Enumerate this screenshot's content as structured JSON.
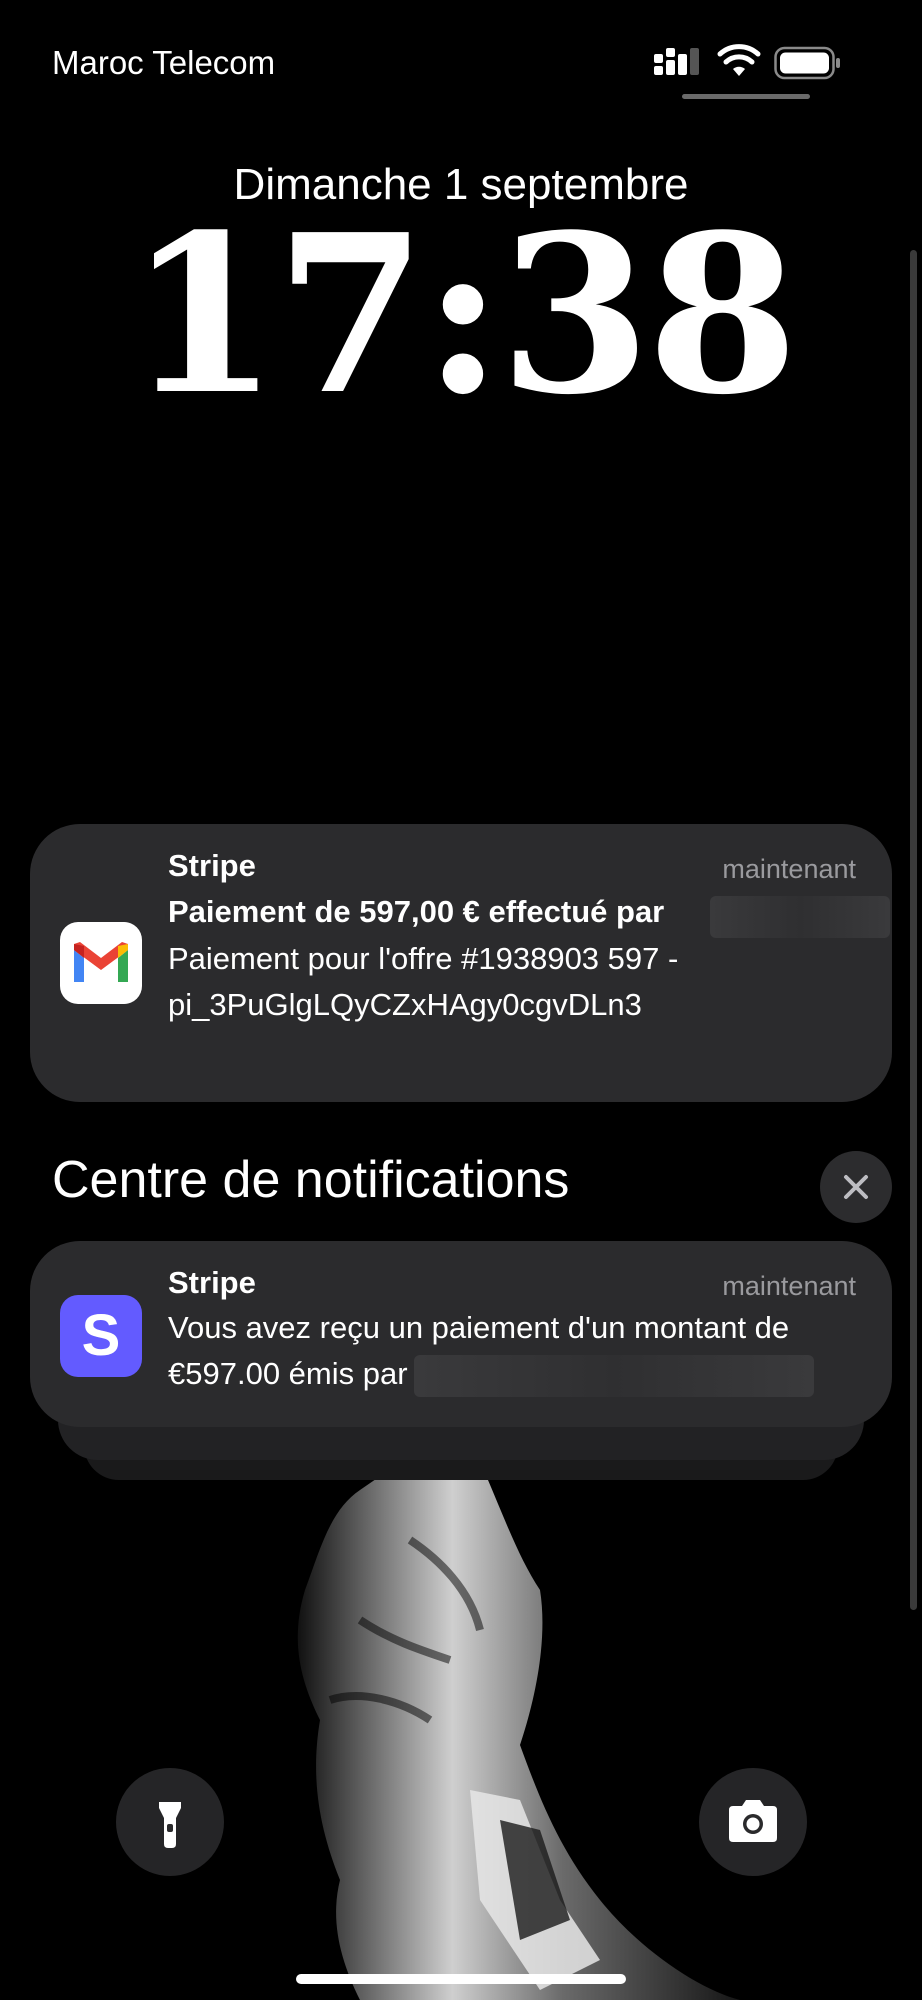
{
  "status_bar": {
    "carrier": "Maroc Telecom",
    "signal_icon": "cellular-signal-icon",
    "wifi_icon": "wifi-icon",
    "battery_icon": "battery-icon"
  },
  "lock_screen": {
    "date": "Dimanche 1 septembre",
    "time": "17:38"
  },
  "notifications": [
    {
      "app": "Stripe",
      "icon": "gmail-icon",
      "time": "maintenant",
      "title": "Paiement de 597,00 € effectué par",
      "body": "Paiement pour l'offre #1938903 597 - pi_3PuGlgLQyCZxHAgy0cgvDLn3"
    }
  ],
  "notification_center": {
    "title": "Centre de notifications",
    "close_icon": "close-icon",
    "items": [
      {
        "app": "Stripe",
        "icon": "stripe-icon",
        "icon_letter": "S",
        "time": "maintenant",
        "body": "Vous avez reçu un paiement d'un montant de €597.00 émis par"
      }
    ]
  },
  "controls": {
    "flashlight_icon": "flashlight-icon",
    "camera_icon": "camera-icon"
  },
  "colors": {
    "background": "#000000",
    "card": "#2b2b2d",
    "stripe_brand": "#635bff",
    "secondary_text": "#9a9a9e"
  }
}
